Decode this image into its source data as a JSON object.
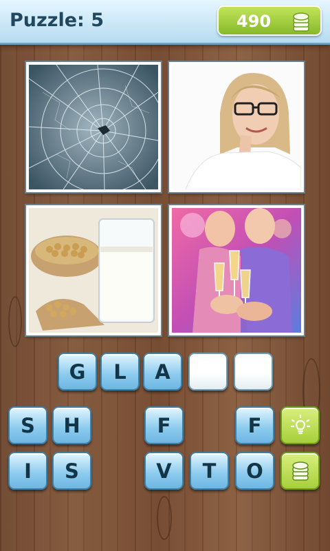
{
  "header": {
    "title": "Puzzle: 5",
    "coins": "490",
    "coin_icon": "coin-stack-icon"
  },
  "pictures": [
    {
      "name": "shattered-glass-picture"
    },
    {
      "name": "woman-with-glasses-picture"
    },
    {
      "name": "soy-milk-glass-picture"
    },
    {
      "name": "champagne-glasses-picture"
    }
  ],
  "answer_slots": [
    "G",
    "L",
    "A",
    "",
    ""
  ],
  "letter_keys": {
    "row1": [
      "S",
      "H",
      "",
      "F",
      "",
      "F"
    ],
    "row2": [
      "I",
      "S",
      "",
      "V",
      "T",
      "O"
    ]
  },
  "actions": {
    "hint_icon": "lightbulb-icon",
    "coins_icon": "coin-stack-icon"
  },
  "colors": {
    "accent_green": "#a7cf3b",
    "key_blue": "#8ccbee",
    "header_text": "#20495f"
  }
}
